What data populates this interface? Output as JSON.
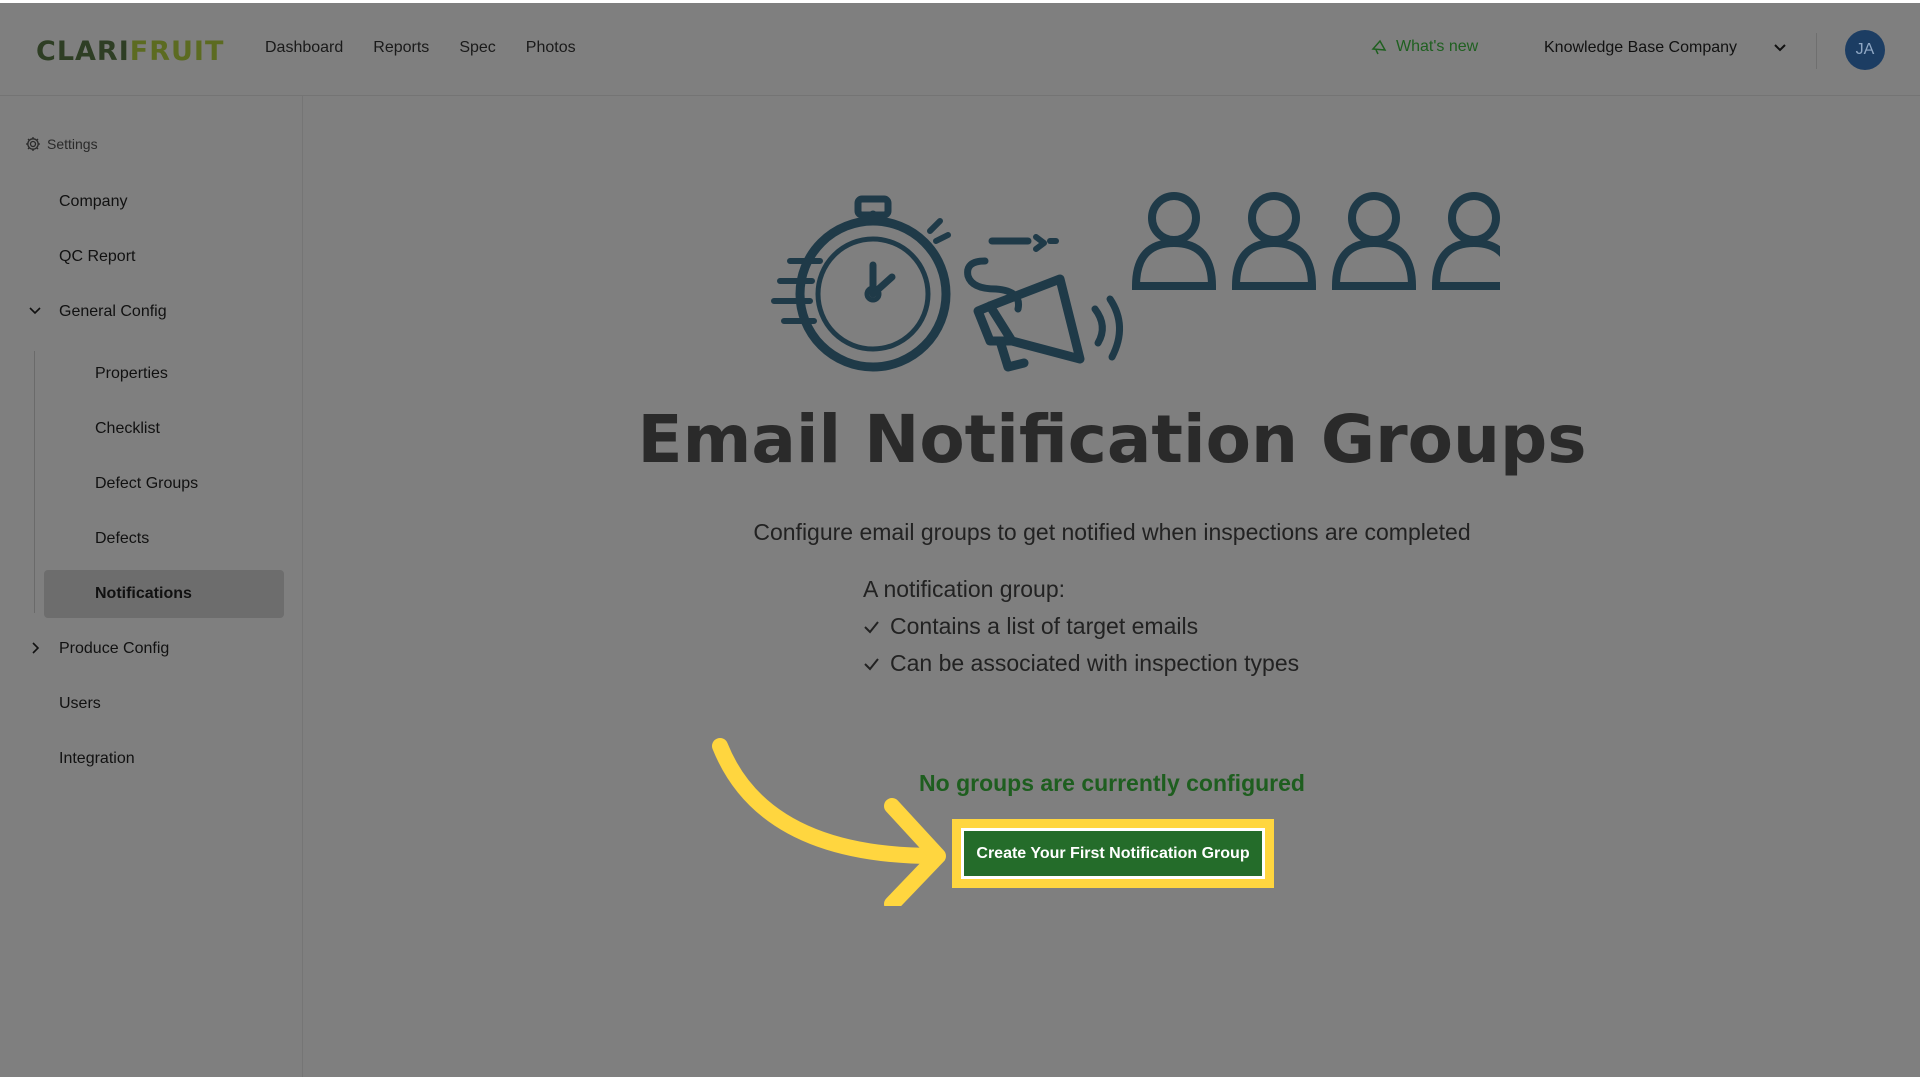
{
  "header": {
    "logo_part1": "CLARI",
    "logo_part2": "FRUIT",
    "nav": [
      "Dashboard",
      "Reports",
      "Spec",
      "Photos"
    ],
    "whats_new": "What's new",
    "company": "Knowledge Base Company",
    "avatar_initials": "JA"
  },
  "sidebar": {
    "settings_label": "Settings",
    "items": [
      {
        "label": "Company"
      },
      {
        "label": "QC Report"
      },
      {
        "label": "General Config"
      },
      {
        "label": "Properties"
      },
      {
        "label": "Checklist"
      },
      {
        "label": "Defect Groups"
      },
      {
        "label": "Defects"
      },
      {
        "label": "Notifications"
      },
      {
        "label": "Produce Config"
      },
      {
        "label": "Users"
      },
      {
        "label": "Integration"
      }
    ]
  },
  "main": {
    "title": "Email Notification Groups",
    "subtitle": "Configure email groups to get notified when inspections are completed",
    "group_heading": "A notification group:",
    "features": [
      "Contains a list of target emails",
      "Can be associated with inspection types"
    ],
    "empty_state": "No groups are currently configured",
    "cta_label": "Create Your First Notification Group"
  },
  "colors": {
    "overlay": "#7f7f7f",
    "brand_green": "#246c2a",
    "highlight": "#ffd63f",
    "icon": "#1f3a48"
  }
}
